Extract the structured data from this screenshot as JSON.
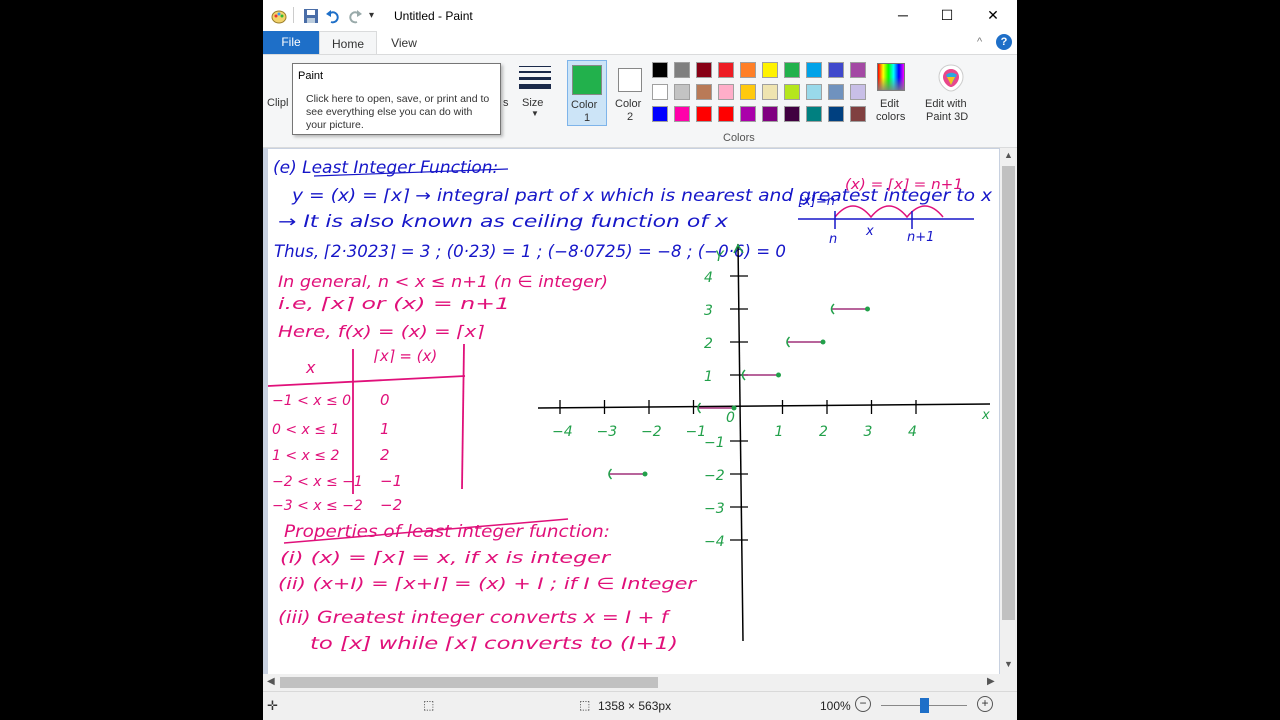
{
  "window": {
    "title": "Untitled - Paint",
    "controls": {
      "minimize": "─",
      "maximize": "☐",
      "close": "✕"
    }
  },
  "tabs": {
    "file": "File",
    "home": "Home",
    "view": "View"
  },
  "ribbon": {
    "clipboard_partial": "Clipl",
    "shapes_partial": "s",
    "size_label": "Size",
    "color1_label": "Color\n1",
    "color1": "Color",
    "color1_num": "1",
    "color2": "Color",
    "color2_num": "2",
    "colors_group": "Colors",
    "edit_colors": "Edit",
    "edit_colors_2": "colors",
    "paint3d": "Edit with",
    "paint3d_2": "Paint 3D",
    "accent_color": "#22b14c",
    "palette_row1": [
      "#000000",
      "#7f7f7f",
      "#880015",
      "#ed1c24",
      "#ff7f27",
      "#fff200",
      "#22b14c",
      "#00a2e8",
      "#3f48cc",
      "#a349a4"
    ],
    "palette_row2": [
      "#ffffff",
      "#c3c3c3",
      "#b97a57",
      "#ffaec9",
      "#ffc90e",
      "#efe4b0",
      "#b5e61d",
      "#99d9ea",
      "#7092be",
      "#c8bfe7"
    ],
    "palette_row3": [
      "#0000ff",
      "#ff00aa",
      "#ff0000",
      "#ff0000",
      "#aa00aa",
      "#800080",
      "#400040",
      "#008080",
      "#004080",
      "#804040"
    ]
  },
  "tooltip": {
    "title": "Paint",
    "body": "Click here to open, save, or print and to see everything else you can do with your picture."
  },
  "notes": {
    "line1": "(e) Least Integer Function:",
    "line2": "y = (x) = ⌈x⌉ → integral part of x which is nearest and greatest integer to x",
    "line3": "→ It is also known as ceiling function of x",
    "line4": "Thus, ⌈2·3023⌉ = 3 ; (0·23) = 1 ; (−8·0725) = −8 ; (−0·6) = 0",
    "inset": "[x]=n   (x) = ⌈x⌉ = n+1",
    "inset_n": "n",
    "inset_x": "x",
    "inset_n1": "n+1",
    "gen1": "In general, n < x ≤ n+1 (n ∈ integer)",
    "gen2": "i.e, ⌈x⌉ or (x) = n+1",
    "gen3": "Here, f(x) = (x) = ⌈x⌉",
    "table_h1": "x",
    "table_h2": "⌈x⌉ = (x)",
    "table_rows": [
      {
        "x": "−1 < x ≤ 0",
        "v": "0"
      },
      {
        "x": "0 < x ≤ 1",
        "v": "1"
      },
      {
        "x": "1 < x ≤ 2",
        "v": "2"
      },
      {
        "x": "−2 < x ≤ −1",
        "v": "−1"
      },
      {
        "x": "−3 < x ≤ −2",
        "v": "−2"
      }
    ],
    "props_title": "Properties of least integer function:",
    "prop1": "(i) (x) = ⌈x⌉ = x, if x is integer",
    "prop2": "(ii) (x+I) = ⌈x+I⌉ = (x) + I ; if I ∈ Integer",
    "prop3": "(iii) Greatest integer converts x = I + f",
    "prop4": "to [x] while ⌈x⌉ converts to (I+1)"
  },
  "graph": {
    "y_label": "Y",
    "x_label": "x",
    "x_ticks": [
      "−4",
      "−3",
      "−2",
      "−1",
      "0",
      "1",
      "2",
      "3",
      "4"
    ],
    "y_ticks": [
      "4",
      "3",
      "2",
      "1",
      "−1",
      "−2",
      "−3",
      "−4"
    ]
  },
  "status": {
    "dimensions": "1358 × 563px",
    "zoom": "100%",
    "zoom_value": 1.0
  }
}
